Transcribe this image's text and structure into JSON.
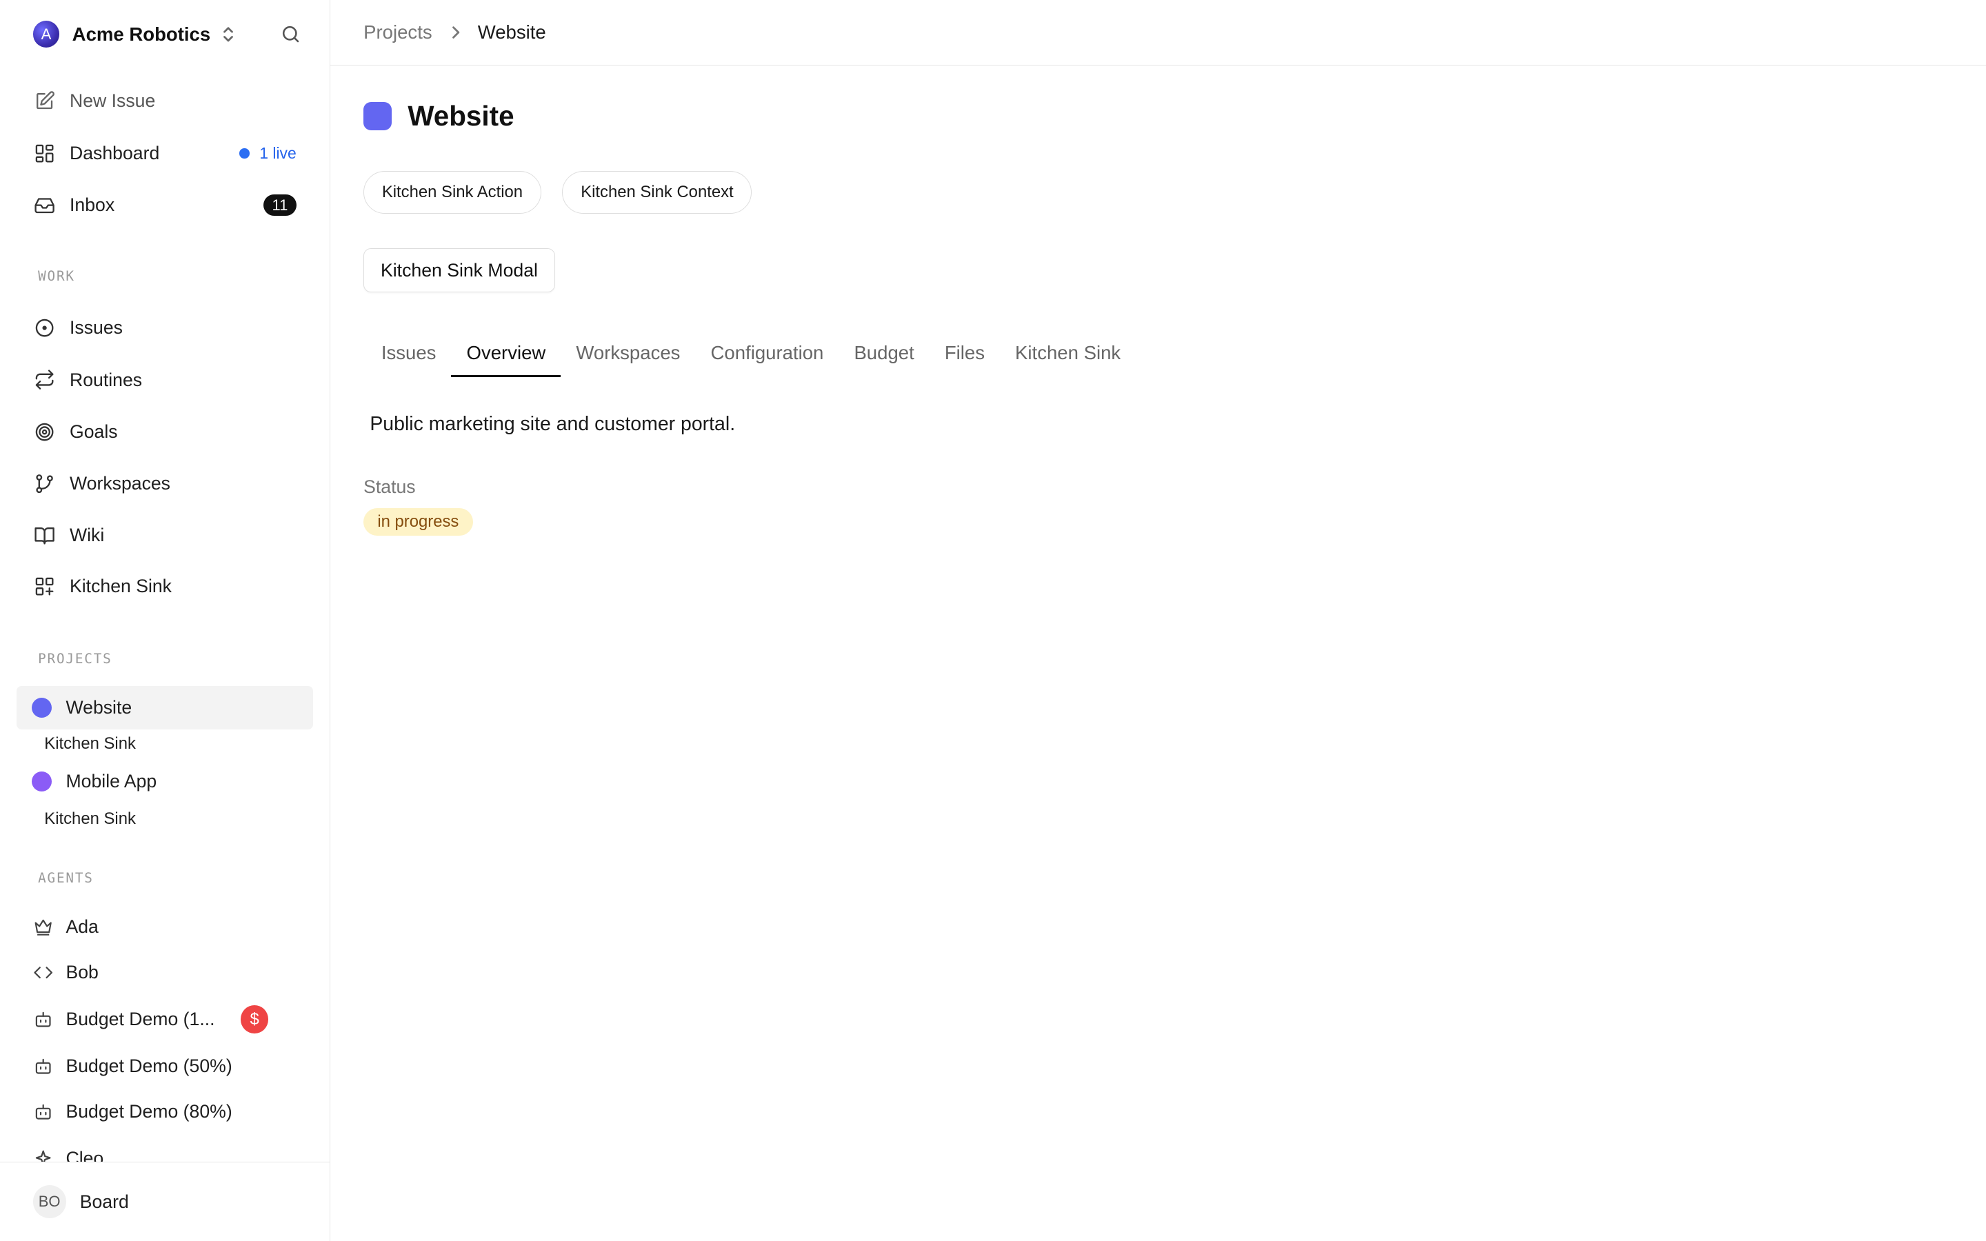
{
  "sidebar": {
    "company": "Acme Robotics",
    "logo_letter": "A",
    "new_issue": "New Issue",
    "dashboard": "Dashboard",
    "live_badge": "1 live",
    "inbox": "Inbox",
    "inbox_count": "11",
    "work_section": "WORK",
    "work_items": [
      {
        "label": "Issues",
        "icon": "circle-dot-icon"
      },
      {
        "label": "Routines",
        "icon": "repeat-icon"
      },
      {
        "label": "Goals",
        "icon": "target-icon"
      },
      {
        "label": "Workspaces",
        "icon": "git-branch-icon"
      },
      {
        "label": "Wiki",
        "icon": "book-open-icon"
      },
      {
        "label": "Kitchen Sink",
        "icon": "grid-plus-icon"
      }
    ],
    "projects_section": "PROJECTS",
    "projects": [
      {
        "label": "Website",
        "color": "#6366f1",
        "sub": "Kitchen Sink"
      },
      {
        "label": "Mobile App",
        "color": "#8b5cf6",
        "sub": "Kitchen Sink"
      }
    ],
    "agents_section": "AGENTS",
    "agents": [
      {
        "label": "Ada",
        "icon": "crown-icon"
      },
      {
        "label": "Bob",
        "icon": "code-icon"
      },
      {
        "label": "Budget Demo (1...",
        "icon": "bot-icon",
        "badge": "$"
      },
      {
        "label": "Budget Demo (50%)",
        "icon": "bot-icon"
      },
      {
        "label": "Budget Demo (80%)",
        "icon": "bot-icon"
      },
      {
        "label": "Cleo",
        "icon": "sparkle-icon"
      }
    ],
    "footer": {
      "avatar": "BO",
      "name": "Board"
    }
  },
  "breadcrumb": {
    "parent": "Projects",
    "current": "Website"
  },
  "main": {
    "title": "Website",
    "title_color": "#6366f1",
    "buttons": [
      "Kitchen Sink Action",
      "Kitchen Sink Context"
    ],
    "modal_button": "Kitchen Sink Modal",
    "tabs": [
      "Issues",
      "Overview",
      "Workspaces",
      "Configuration",
      "Budget",
      "Files",
      "Kitchen Sink"
    ],
    "active_tab": "Overview",
    "description": "Public marketing site and customer portal.",
    "status_label": "Status",
    "status_value": "in progress"
  }
}
